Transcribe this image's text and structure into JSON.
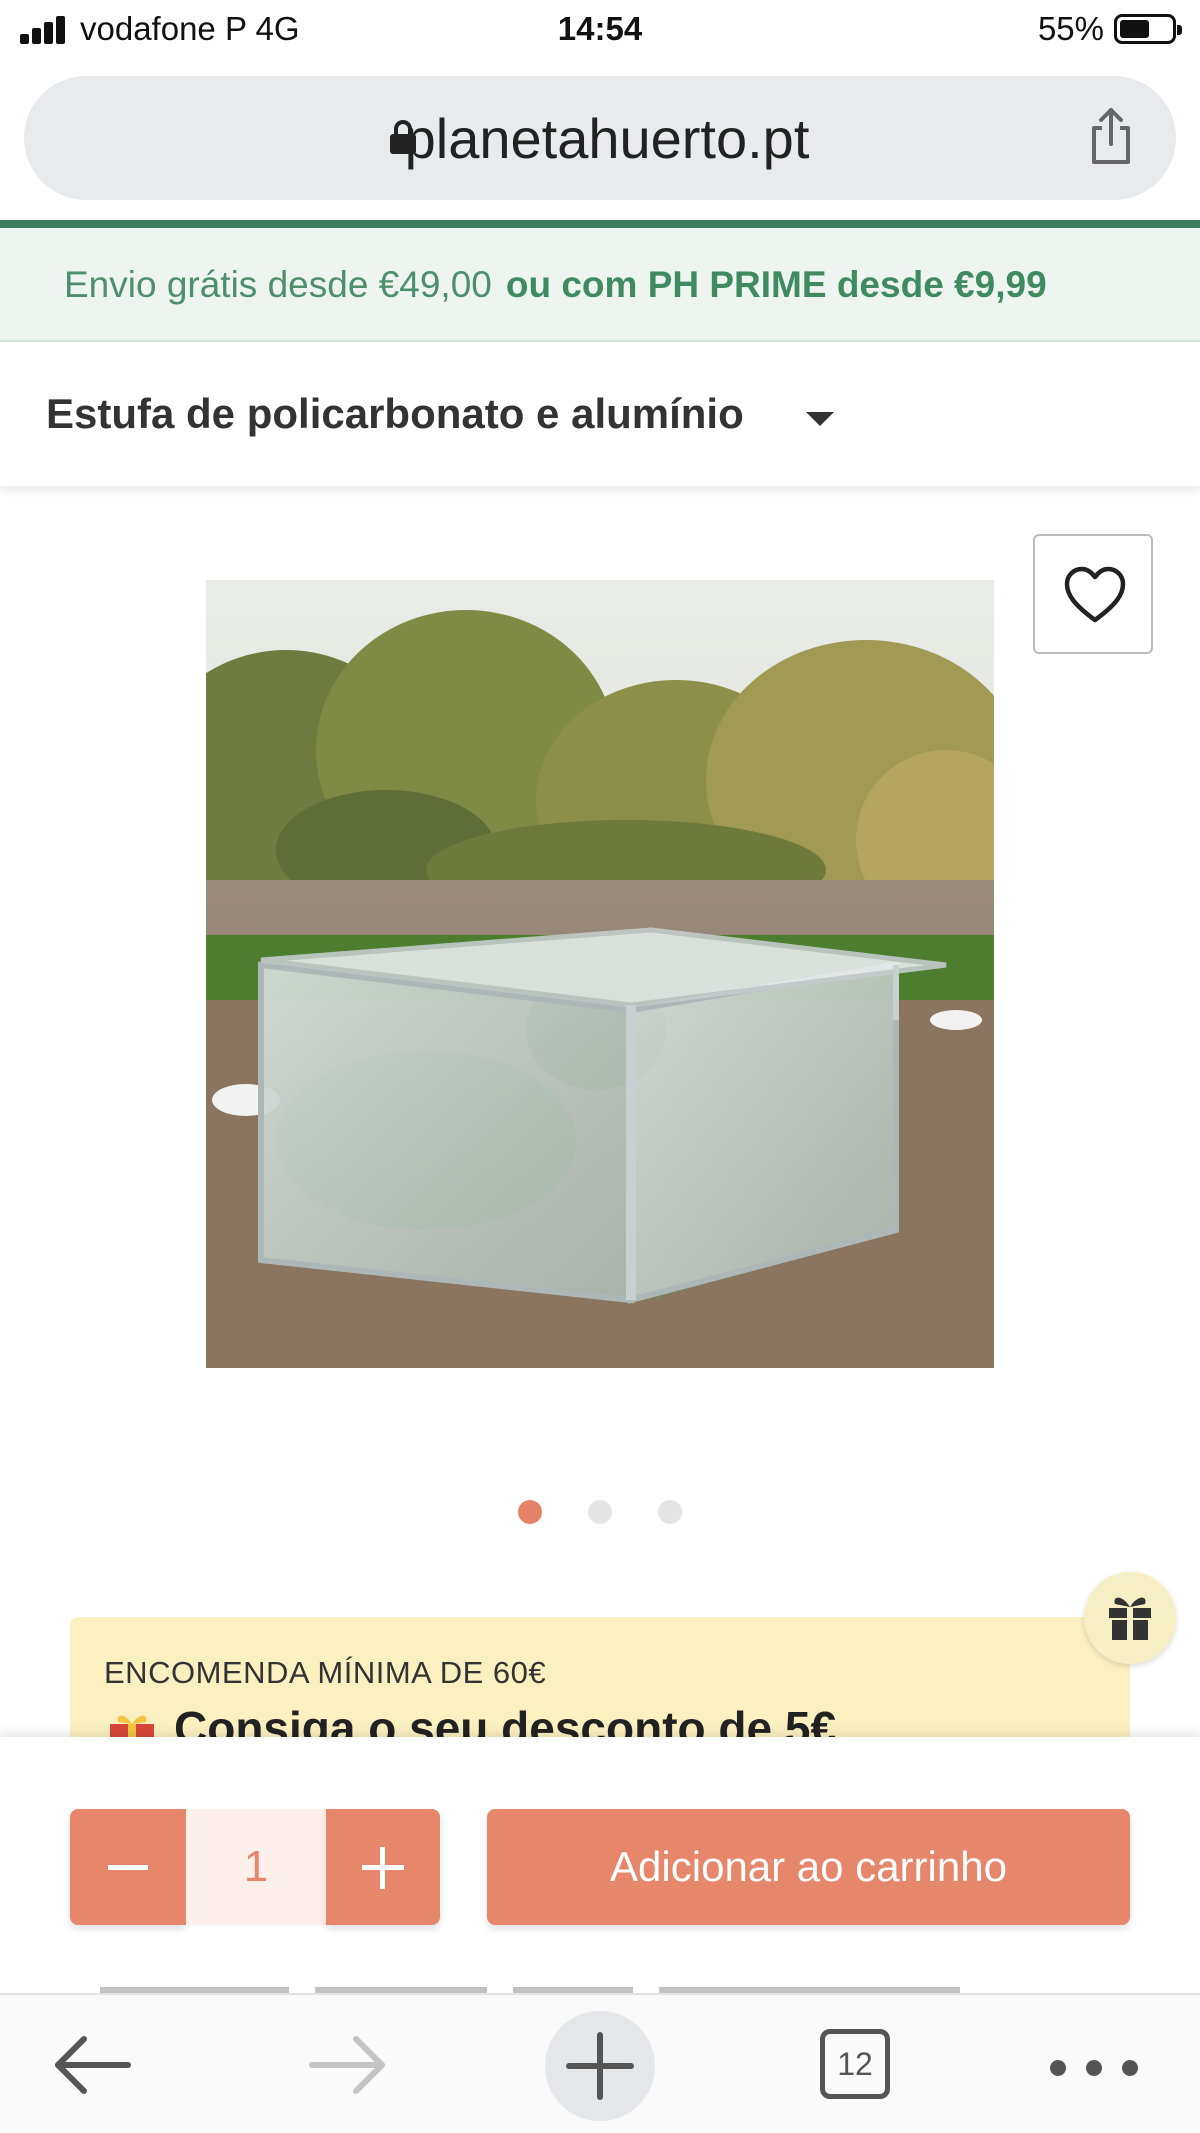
{
  "status_bar": {
    "carrier": "vodafone P  4G",
    "time": "14:54",
    "battery": "55%"
  },
  "browser": {
    "url": "planetahuerto.pt",
    "tab_count": "12"
  },
  "shipping_banner": {
    "text": "Envio grátis desde €49,00",
    "prime_text": "ou com PH PRIME desde €9,99"
  },
  "product": {
    "title": "Estufa de policarbonato e alumínio",
    "gallery_count": 3,
    "gallery_active_index": 0
  },
  "promo": {
    "label": "ENCOMENDA MÍNIMA DE 60€",
    "headline": "Consiga o seu desconto de 5€"
  },
  "cart": {
    "quantity": "1",
    "add_label": "Adicionar ao carrinho"
  },
  "colors": {
    "accent": "#e6876c",
    "brand_green": "#3e7b5e",
    "promo_bg": "#fbf1c0"
  }
}
